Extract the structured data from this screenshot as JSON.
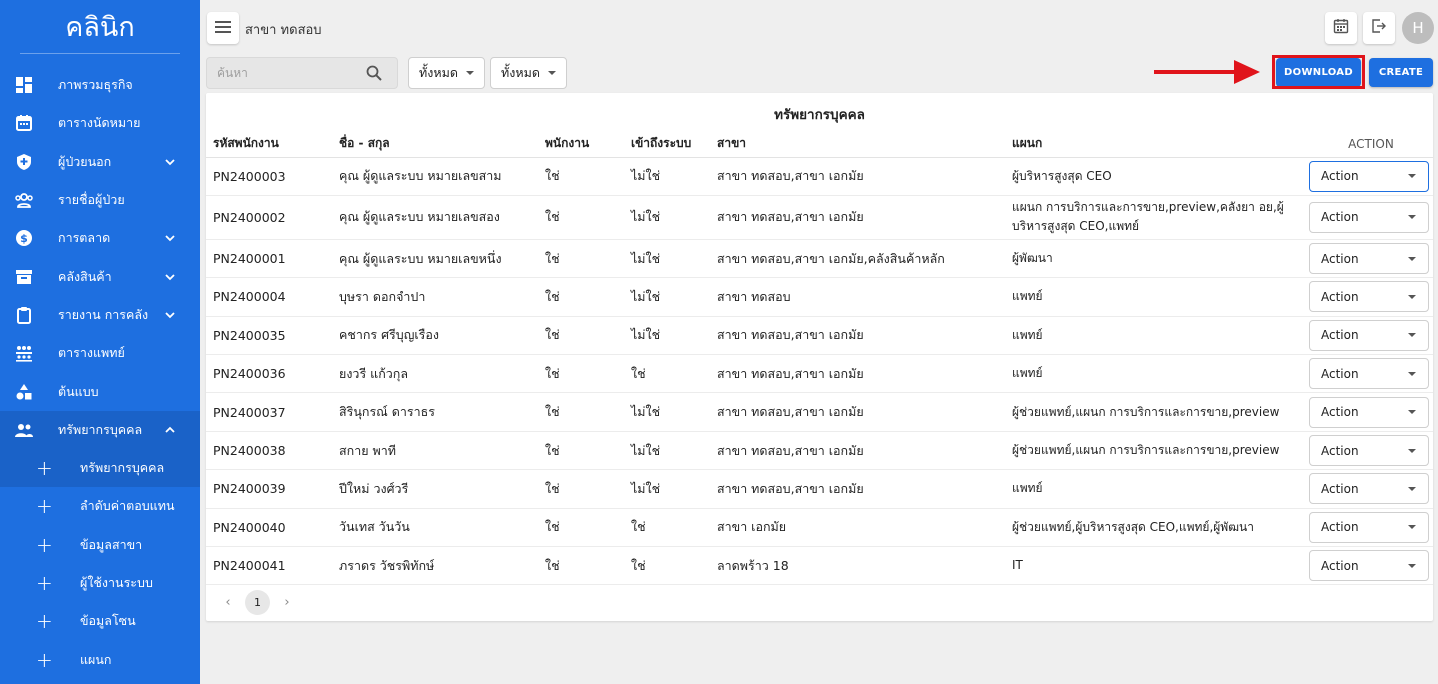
{
  "brand": "คลินิก",
  "nav": [
    {
      "label": "ภาพรวมธุรกิจ",
      "icon": "dashboard-icon"
    },
    {
      "label": "ตารางนัดหมาย",
      "icon": "calendar-icon"
    },
    {
      "label": "ผู้ป่วยนอก",
      "icon": "shield-icon"
    },
    {
      "label": "รายชื่อผู้ป่วย",
      "icon": "patients-icon"
    },
    {
      "label": "การตลาด",
      "icon": "dollar-icon"
    },
    {
      "label": "คลังสินค้า",
      "icon": "archive-icon"
    },
    {
      "label": "รายงาน การคลัง",
      "icon": "clipboard-icon"
    },
    {
      "label": "ตารางแพทย์",
      "icon": "doctor-schedule-icon"
    },
    {
      "label": "ต้นแบบ",
      "icon": "shapes-icon"
    },
    {
      "label": "ทรัพยากรบุคคล",
      "icon": "people-icon"
    }
  ],
  "subnav": [
    {
      "label": "ทรัพยากรบุคคล"
    },
    {
      "label": "ลำดับค่าตอบแทน"
    },
    {
      "label": "ข้อมูลสาขา"
    },
    {
      "label": "ผู้ใช้งานระบบ"
    },
    {
      "label": "ข้อมูลโซน"
    },
    {
      "label": "แผนก"
    }
  ],
  "topbar": {
    "branch_title": "สาขา ทดสอบ",
    "avatar_initial": "H"
  },
  "filters": {
    "search_placeholder": "ค้นหา",
    "filter1": "ทั้งหมด",
    "filter2": "ทั้งหมด"
  },
  "buttons": {
    "download": "DOWNLOAD",
    "create": "CREATE"
  },
  "table": {
    "title": "ทรัพยากรบุคคล",
    "headers": [
      "รหัสพนักงาน",
      "ชื่อ - สกุล",
      "พนักงาน",
      "เข้าถึงระบบ",
      "สาขา",
      "แผนก",
      "ACTION"
    ],
    "action_label": "Action",
    "rows": [
      {
        "id": "PN2400003",
        "name": "คุณ ผู้ดูแลระบบ หมายเลขสาม",
        "employee": "ใช่",
        "access": "ไม่ใช่",
        "branch": "สาขา ทดสอบ,สาขา เอกมัย",
        "dept": "ผู้บริหารสูงสุด CEO"
      },
      {
        "id": "PN2400002",
        "name": "คุณ ผู้ดูแลระบบ หมายเลขสอง",
        "employee": "ใช่",
        "access": "ไม่ใช่",
        "branch": "สาขา ทดสอบ,สาขา เอกมัย",
        "dept": "แผนก การบริการและการขาย,preview,คลังยา อย,ผู้บริหารสูงสุด CEO,แพทย์"
      },
      {
        "id": "PN2400001",
        "name": "คุณ ผู้ดูแลระบบ หมายเลขหนึ่ง",
        "employee": "ใช่",
        "access": "ไม่ใช่",
        "branch": "สาขา ทดสอบ,สาขา เอกมัย,คลังสินค้าหลัก",
        "dept": "ผู้พัฒนา"
      },
      {
        "id": "PN2400004",
        "name": "บุษรา ดอกจำปา",
        "employee": "ใช่",
        "access": "ไม่ใช่",
        "branch": "สาขา ทดสอบ",
        "dept": "แพทย์"
      },
      {
        "id": "PN2400035",
        "name": "คชากร ศรีบุญเรือง",
        "employee": "ใช่",
        "access": "ไม่ใช่",
        "branch": "สาขา ทดสอบ,สาขา เอกมัย",
        "dept": "แพทย์"
      },
      {
        "id": "PN2400036",
        "name": "ยงวรี แก้วกุล",
        "employee": "ใช่",
        "access": "ใช่",
        "branch": "สาขา ทดสอบ,สาขา เอกมัย",
        "dept": "แพทย์"
      },
      {
        "id": "PN2400037",
        "name": "สิรินุกรณ์ ดาราธร",
        "employee": "ใช่",
        "access": "ไม่ใช่",
        "branch": "สาขา ทดสอบ,สาขา เอกมัย",
        "dept": "ผู้ช่วยแพทย์,แผนก การบริการและการขาย,preview"
      },
      {
        "id": "PN2400038",
        "name": "สกาย พาที",
        "employee": "ใช่",
        "access": "ไม่ใช่",
        "branch": "สาขา ทดสอบ,สาขา เอกมัย",
        "dept": "ผู้ช่วยแพทย์,แผนก การบริการและการขาย,preview"
      },
      {
        "id": "PN2400039",
        "name": "ปีใหม่ วงศ์วรี",
        "employee": "ใช่",
        "access": "ไม่ใช่",
        "branch": "สาขา ทดสอบ,สาขา เอกมัย",
        "dept": "แพทย์"
      },
      {
        "id": "PN2400040",
        "name": "วันเทส วันวัน",
        "employee": "ใช่",
        "access": "ใช่",
        "branch": "สาขา เอกมัย",
        "dept": "ผู้ช่วยแพทย์,ผู้บริหารสูงสุด CEO,แพทย์,ผู้พัฒนา"
      },
      {
        "id": "PN2400041",
        "name": "ภราดร วัชรพิทักษ์",
        "employee": "ใช่",
        "access": "ใช่",
        "branch": "ลาดพร้าว 18",
        "dept": "IT"
      }
    ]
  },
  "pagination": {
    "current": "1"
  },
  "colors": {
    "primary": "#1e6fe0",
    "highlight": "#e0141b"
  }
}
